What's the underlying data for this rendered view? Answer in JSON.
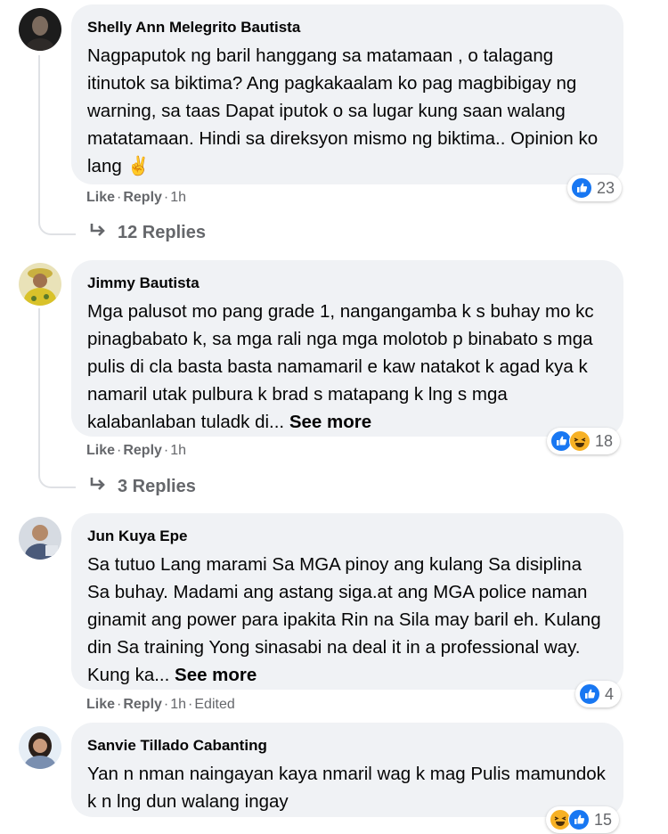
{
  "comments": [
    {
      "author": "Shelly Ann Melegrito Bautista",
      "text": "Nagpaputok ng baril hanggang sa matamaan , o talagang itinutok sa biktima? Ang pagkakaalam ko pag magbibigay ng warning, sa taas Dapat iputok o sa lugar kung saan walang matatamaan. Hindi sa direksyon mismo ng biktima.. Opinion ko lang",
      "emoji": "✌",
      "like": "Like",
      "reply": "Reply",
      "time": "1h",
      "reaction_count": "23",
      "reactions": [
        "like-icon"
      ],
      "replies_label": "12 Replies"
    },
    {
      "author": "Jimmy Bautista",
      "text": "Mga palusot mo pang grade 1, nangangamba k s buhay mo kc pinagbabato k, sa mga rali nga mga molotob p binabato s mga pulis di cla basta basta namamaril e kaw natakot k agad kya k namaril utak pulbura k brad s matapang k lng s mga kalabanlaban tuladk di...",
      "see_more": "See more",
      "like": "Like",
      "reply": "Reply",
      "time": "1h",
      "reaction_count": "18",
      "reactions": [
        "like-icon",
        "haha-icon"
      ],
      "replies_label": "3 Replies"
    },
    {
      "author": "Jun Kuya Epe",
      "text": "Sa tutuo Lang marami Sa MGA pinoy ang kulang Sa disiplina Sa buhay. Madami ang astang siga.at ang MGA police naman ginamit ang power para ipakita Rin na Sila may baril eh. Kulang din Sa training Yong sinasabi na deal it in a professional way. Kung ka...",
      "see_more": "See more",
      "like": "Like",
      "reply": "Reply",
      "time": "1h",
      "edited": "Edited",
      "reaction_count": "4",
      "reactions": [
        "like-icon"
      ]
    },
    {
      "author": "Sanvie Tillado Cabanting",
      "text": "Yan n nman naingayan kaya nmaril wag k mag Pulis mamundok k n lng dun walang ingay",
      "reaction_count": "15",
      "reactions": [
        "haha-icon",
        "like-icon"
      ]
    }
  ],
  "colors": {
    "bubble": "#f0f2f5",
    "meta": "#65676b",
    "like_blue": "#1877f2",
    "haha_yellow": "#f7b125"
  }
}
